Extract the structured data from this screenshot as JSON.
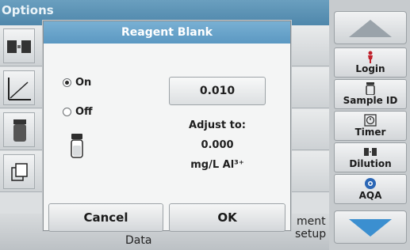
{
  "background": {
    "title": "Options",
    "bottom_left_partial": "",
    "bottom_right_partial_1": "ment",
    "bottom_right_partial_2": "setup",
    "bottom_mid_partial": "Data"
  },
  "sidebar": {
    "items": [
      {
        "name": "login",
        "label": "Login",
        "icon": "person-icon"
      },
      {
        "name": "sample-id",
        "label": "Sample ID",
        "icon": "vial-icon"
      },
      {
        "name": "timer",
        "label": "Timer",
        "icon": "timer-icon"
      },
      {
        "name": "dilution",
        "label": "Dilution",
        "icon": "dilution-icon"
      },
      {
        "name": "aqa",
        "label": "AQA",
        "icon": "aqa-icon"
      }
    ]
  },
  "dialog": {
    "title": "Reagent Blank",
    "options": [
      {
        "label": "On",
        "selected": true
      },
      {
        "label": "Off",
        "selected": false
      }
    ],
    "value": "0.010",
    "adjust_label": "Adjust to:",
    "adjust_value": "0.000",
    "unit": "mg/L Al³⁺",
    "cancel_label": "Cancel",
    "ok_label": "OK"
  },
  "colors": {
    "title_bar": "#5b98c2",
    "sidebar": "#c7cbce",
    "arrow_up": "#9aa3aa",
    "arrow_down": "#3b8fd0"
  }
}
